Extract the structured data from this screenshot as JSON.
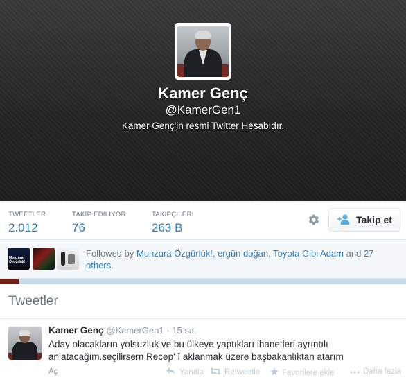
{
  "profile": {
    "name": "Kamer Genç",
    "handle": "@KamerGen1",
    "bio": "Kamer Genç'in resmi Twitter Hesabıdır."
  },
  "stats": [
    {
      "label": "TWEETLER",
      "value": "2.012"
    },
    {
      "label": "TAKIP EDILIYOR",
      "value": "76"
    },
    {
      "label": "TAKIPÇILERI",
      "value": "263 B"
    }
  ],
  "follow_button": {
    "label": "Takip et",
    "icon": "add-user-icon"
  },
  "settings_icon": "gear-icon",
  "followed_by": {
    "prefix": "Followed by",
    "users": [
      "Munzura Özgürlük!",
      "ergün doğan",
      "Toyota Gibi Adam"
    ],
    "separator": ",",
    "conjunction": "and",
    "others": "27 others.",
    "thumb1_text": "Munzura Özgürlük!"
  },
  "tweets_section": {
    "heading": "Tweetler"
  },
  "tweet": {
    "name": "Kamer Genç",
    "handle": "@KamerGen1",
    "time": "· 15 sa.",
    "text": "Aday olacakların yolsuzluk ve bu ülkeye yaptıkları ihanetleri ayrıntılı anlatacağım.seçilirsem Recep' î aklanmak üzere başbakanlıktan atarım",
    "actions": {
      "open": "Aç",
      "reply": "Yanıtla",
      "retweet": "Retweetle",
      "favorite": "Favorilere ekle",
      "more": "Daha fazla"
    }
  },
  "colors": {
    "link": "#2b7bb9",
    "muted": "#66757f",
    "header_bg": "#2a2a2a"
  }
}
